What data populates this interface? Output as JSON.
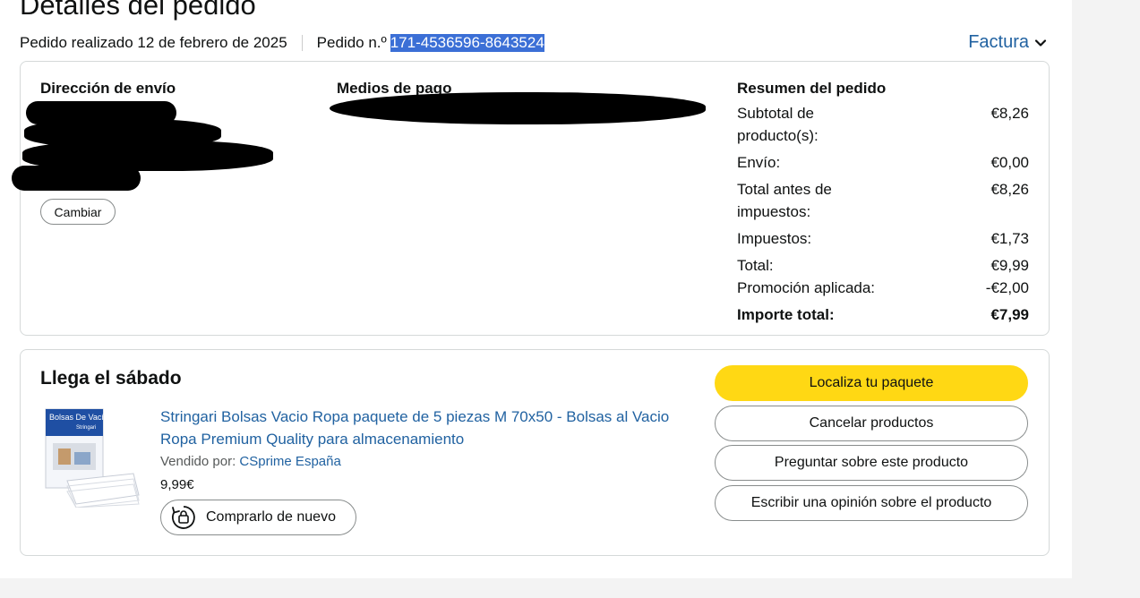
{
  "header": {
    "title": "Detalles del pedido",
    "placed": "Pedido realizado 12 de febrero de 2025",
    "order_label": "Pedido n.º",
    "order_number": "171-4536596-8643524",
    "invoice": "Factura"
  },
  "shipping": {
    "heading": "Dirección de envío",
    "change_button": "Cambiar"
  },
  "payment": {
    "heading": "Medios de pago"
  },
  "summary": {
    "heading": "Resumen del pedido",
    "rows": [
      {
        "label": "Subtotal de producto(s):",
        "value": "€8,26"
      },
      {
        "label": "Envío:",
        "value": "€0,00"
      },
      {
        "label": "Total antes de impuestos:",
        "value": "€8,26"
      },
      {
        "label": "Impuestos:",
        "value": "€1,73"
      },
      {
        "label": "Total:",
        "value": "€9,99"
      },
      {
        "label": "Promoción aplicada:",
        "value": "-€2,00"
      },
      {
        "label": "Importe total:",
        "value": "€7,99"
      }
    ]
  },
  "shipment": {
    "heading": "Llega el sábado",
    "product_title": "Stringari Bolsas Vacio Ropa paquete de 5 piezas M 70x50 - Bolsas al Vacio Ropa Premium Quality para almacenamiento",
    "sold_by_label": "Vendido por:",
    "seller": "CSprime España",
    "price": "9,99€",
    "buy_again": "Comprarlo de nuevo",
    "thumb_brand": "Bolsas De Vacío",
    "thumb_logo": "Stringari"
  },
  "actions": {
    "track": "Localiza tu paquete",
    "cancel": "Cancelar productos",
    "ask": "Preguntar sobre este producto",
    "review": "Escribir una opinión sobre el producto"
  },
  "colors": {
    "link": "#2162a1",
    "primary_button": "#ffd814",
    "selection": "#3b6fd6"
  }
}
